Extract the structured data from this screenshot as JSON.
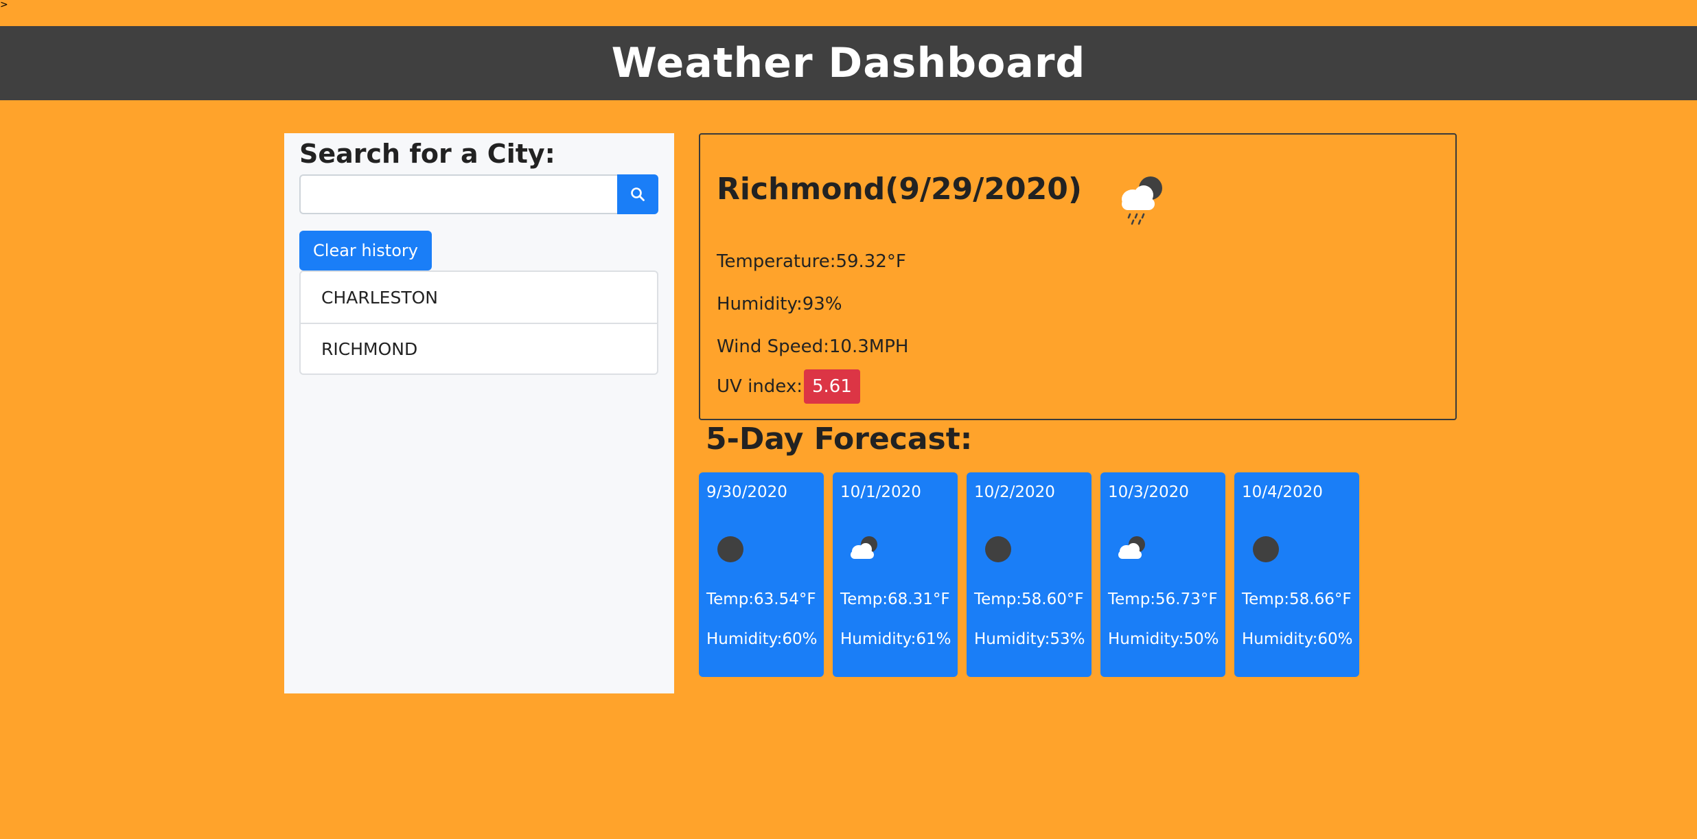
{
  "page": {
    "stray_mark": ">"
  },
  "header": {
    "title": "Weather Dashboard"
  },
  "sidebar": {
    "heading": "Search for a City:",
    "search_value": "",
    "search_placeholder": "",
    "search_icon": "search-icon",
    "clear_label": "Clear history",
    "history": [
      "CHARLESTON",
      "RICHMOND"
    ]
  },
  "current": {
    "title": "Richmond(9/29/2020)",
    "icon": "rain-cloud-night-icon",
    "temperature": "Temperature:59.32°F",
    "humidity": "Humidity:93%",
    "wind": "Wind Speed:10.3MPH",
    "uv_label": "UV index:",
    "uv_value": "5.61"
  },
  "forecast": {
    "title": "5-Day Forecast:",
    "days": [
      {
        "date": "9/30/2020",
        "icon": "moon-icon",
        "temp": "Temp:63.54°F",
        "humidity": "Humidity:60%"
      },
      {
        "date": "10/1/2020",
        "icon": "cloud-night-icon",
        "temp": "Temp:68.31°F",
        "humidity": "Humidity:61%"
      },
      {
        "date": "10/2/2020",
        "icon": "moon-icon",
        "temp": "Temp:58.60°F",
        "humidity": "Humidity:53%"
      },
      {
        "date": "10/3/2020",
        "icon": "cloud-night-icon",
        "temp": "Temp:56.73°F",
        "humidity": "Humidity:50%"
      },
      {
        "date": "10/4/2020",
        "icon": "moon-icon",
        "temp": "Temp:58.66°F",
        "humidity": "Humidity:60%"
      }
    ]
  },
  "colors": {
    "background": "#ffa32b",
    "navbar": "#404040",
    "primary": "#1a7ef7",
    "uv_badge": "#dc3545",
    "sidebar": "#f7f8fa"
  }
}
